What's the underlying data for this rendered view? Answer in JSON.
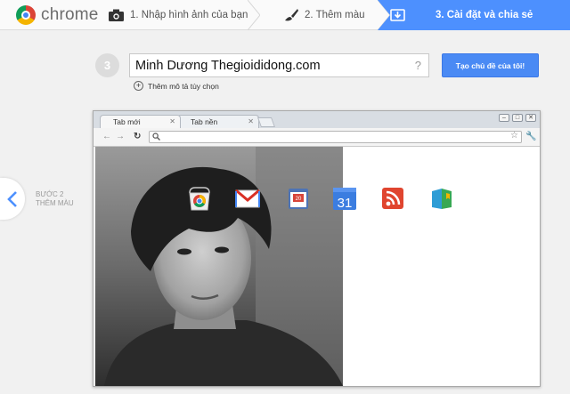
{
  "header": {
    "logo_text": "chrome",
    "steps": [
      {
        "label": "1. Nhập hình ảnh của bạn",
        "icon": "camera-icon"
      },
      {
        "label": "2. Thêm màu",
        "icon": "paintbrush-icon"
      },
      {
        "label": "3. Cài đặt và chia sẻ",
        "icon": "install-icon",
        "active": true
      }
    ]
  },
  "step3": {
    "number": "3",
    "theme_name": "Minh Dương Thegioididong.com",
    "help": "?",
    "create_button": "Tạo chủ đề của tôi!",
    "add_description": "Thêm mô tả tùy chọn"
  },
  "back_nav": {
    "line1": "BƯỚC 2",
    "line2": "THÊM MÀU"
  },
  "preview": {
    "tabs": [
      "Tab mới",
      "Tab nền"
    ],
    "apps": [
      "chrome-web-store-icon",
      "gmail-icon",
      "calendar-icon",
      "google-calendar-icon",
      "rss-icon",
      "books-icon"
    ],
    "calendar_day": "20",
    "gcal_day": "31"
  },
  "colors": {
    "accent": "#4d90fe",
    "button": "#4a8af4"
  }
}
